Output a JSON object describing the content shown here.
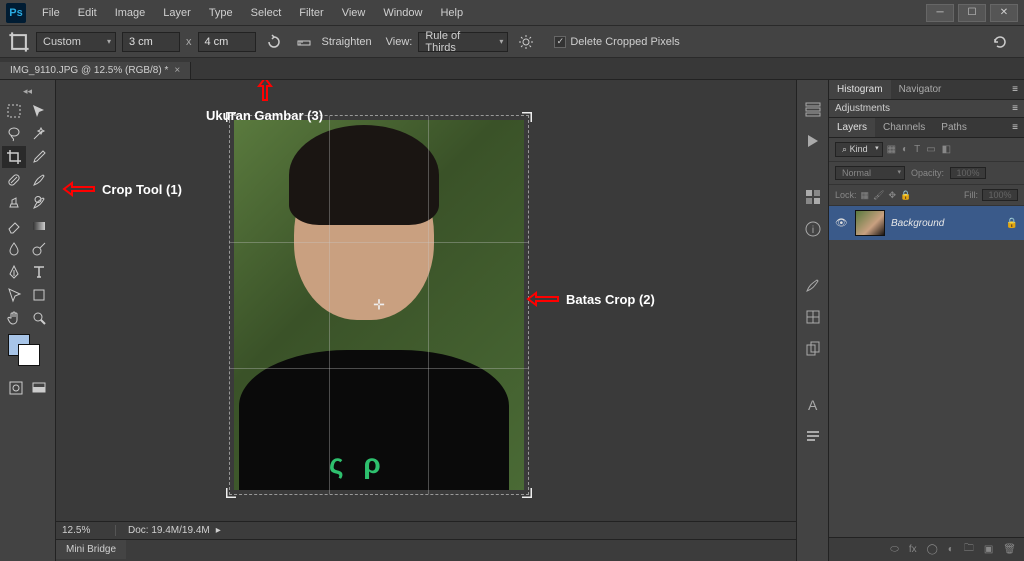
{
  "app": {
    "logo_text": "Ps"
  },
  "menu": [
    "File",
    "Edit",
    "Image",
    "Layer",
    "Type",
    "Select",
    "Filter",
    "View",
    "Window",
    "Help"
  ],
  "options": {
    "preset": "Custom",
    "width": "3 cm",
    "x": "x",
    "height": "4 cm",
    "straighten": "Straighten",
    "view_label": "View:",
    "overlay": "Rule of Thirds",
    "delete_cropped": "Delete Cropped Pixels",
    "delete_cropped_checked": "✓"
  },
  "doc_tab": {
    "title": "IMG_9110.JPG @ 12.5% (RGB/8) *",
    "close": "×"
  },
  "annotations": {
    "crop_tool": "Crop Tool  (1)",
    "ukuran": "Ukuran Gambar  (3)",
    "batas": "Batas Crop  (2)"
  },
  "canvas": {
    "shirt_text": "ς  ρ",
    "center": "✛"
  },
  "status": {
    "zoom": "12.5%",
    "doc": "Doc: 19.4M/19.4M",
    "play": "▸"
  },
  "mini": {
    "label": "Mini Bridge"
  },
  "panels": {
    "histogram": "Histogram",
    "navigator": "Navigator",
    "adjustments": "Adjustments",
    "layers": "Layers",
    "channels": "Channels",
    "paths": "Paths",
    "menu_icon": "≡",
    "kind_label": "Kind",
    "kind_icon": "⌕",
    "blend_mode": "Normal",
    "opacity_label": "Opacity:",
    "opacity_val": "100%",
    "lock_label": "Lock:",
    "fill_label": "Fill:",
    "fill_val": "100%",
    "layer_name": "Background",
    "eye": "👁",
    "lock": "🔒"
  }
}
